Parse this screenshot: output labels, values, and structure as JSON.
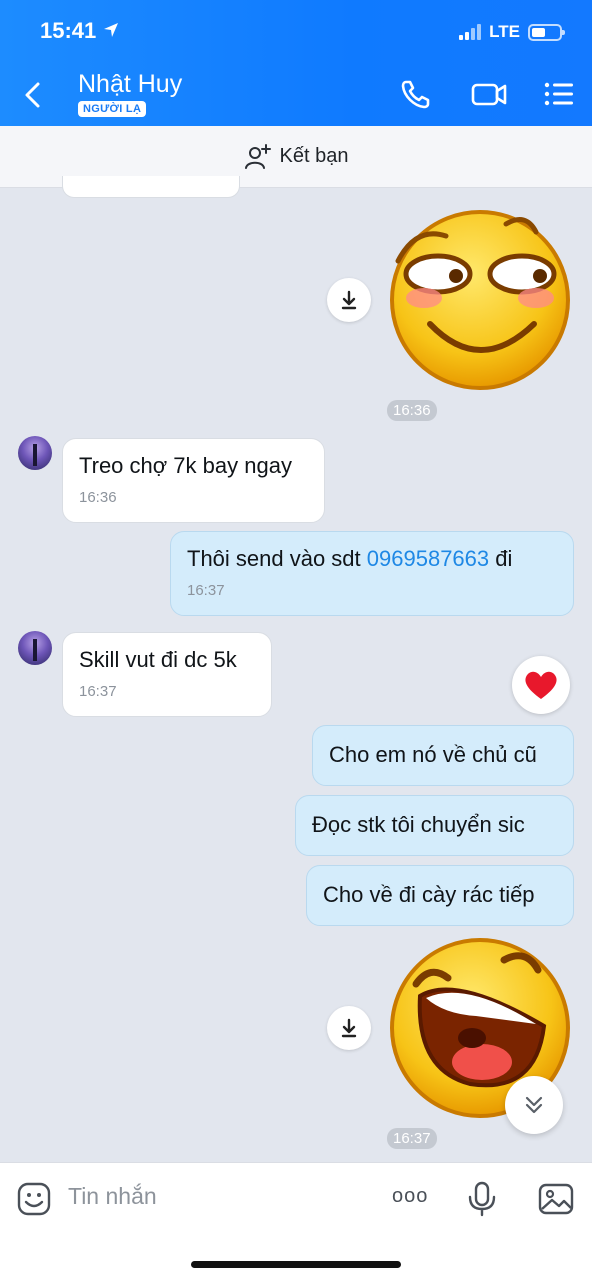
{
  "status": {
    "time": "15:41",
    "network": "LTE"
  },
  "header": {
    "contact_name": "Nhật Huy",
    "badge": "NGƯỜI LẠ"
  },
  "add_friend": {
    "label": "Kết bạn"
  },
  "messages": [
    {
      "timestamp": "16:36"
    },
    {
      "text": "Treo chợ 7k bay ngay",
      "time": "16:36"
    },
    {
      "text_before": "Thôi send vào sdt ",
      "phone": "0969587663",
      "text_after": " đi",
      "time": "16:37"
    },
    {
      "text": "Skill vut đi dc 5k",
      "time": "16:37"
    },
    {
      "text": "Cho em nó về chủ cũ"
    },
    {
      "text": "Đọc stk tôi chuyển sic"
    },
    {
      "text": "Cho về đi cày rác tiếp"
    },
    {
      "timestamp": "16:37"
    }
  ],
  "composer": {
    "placeholder": "Tin nhắn",
    "more": "ooo"
  },
  "colors": {
    "header": "#1379ff",
    "outgoing": "#d4ecfb",
    "incoming": "#ffffff",
    "link": "#1e88e5",
    "heart": "#e8182c"
  },
  "icons": [
    "chevron-left-icon",
    "phone-icon",
    "video-icon",
    "menu-icon",
    "add-user-icon",
    "download-icon",
    "heart-icon",
    "chevron-double-down-icon",
    "emoji-icon",
    "more-icon",
    "microphone-icon",
    "image-icon"
  ]
}
